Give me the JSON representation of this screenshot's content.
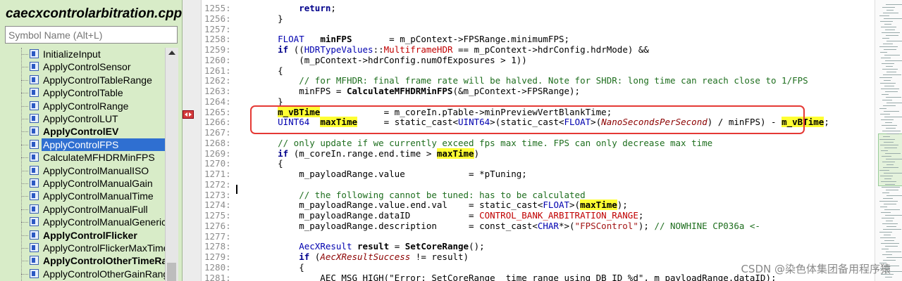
{
  "file_title": "caecxcontrolarbitration.cpp",
  "search": {
    "placeholder": "Symbol Name (Alt+L)"
  },
  "symbols": [
    {
      "label": "InitializeInput",
      "bold": false,
      "selected": false
    },
    {
      "label": "ApplyControlSensor",
      "bold": false,
      "selected": false
    },
    {
      "label": "ApplyControlTableRange",
      "bold": false,
      "selected": false
    },
    {
      "label": "ApplyControlTable",
      "bold": false,
      "selected": false
    },
    {
      "label": "ApplyControlRange",
      "bold": false,
      "selected": false
    },
    {
      "label": "ApplyControlLUT",
      "bold": false,
      "selected": false
    },
    {
      "label": "ApplyControlEV",
      "bold": true,
      "selected": false
    },
    {
      "label": "ApplyControlFPS",
      "bold": false,
      "selected": true
    },
    {
      "label": "CalculateMFHDRMinFPS",
      "bold": false,
      "selected": false
    },
    {
      "label": "ApplyControlManualISO",
      "bold": false,
      "selected": false
    },
    {
      "label": "ApplyControlManualGain",
      "bold": false,
      "selected": false
    },
    {
      "label": "ApplyControlManualTime",
      "bold": false,
      "selected": false
    },
    {
      "label": "ApplyControlManualFull",
      "bold": false,
      "selected": false
    },
    {
      "label": "ApplyControlManualGeneric",
      "bold": false,
      "selected": false
    },
    {
      "label": "ApplyControlFlicker",
      "bold": true,
      "selected": false
    },
    {
      "label": "ApplyControlFlickerMaxTime",
      "bold": false,
      "selected": false
    },
    {
      "label": "ApplyControlOtherTimeRange",
      "bold": true,
      "selected": false
    },
    {
      "label": "ApplyControlOtherGainRange",
      "bold": false,
      "selected": false
    }
  ],
  "code_lines": [
    {
      "n": "1255:",
      "html": "        <span class='kw'>return</span>;"
    },
    {
      "n": "1256:",
      "html": "    }"
    },
    {
      "n": "1257:",
      "html": ""
    },
    {
      "n": "1258:",
      "html": "    <span class='tp'>FLOAT</span>   <b>minFPS</b>       = m_pContext-&gt;FPSRange.minimumFPS;"
    },
    {
      "n": "1259:",
      "html": "    <span class='kw'>if</span> ((<span class='tp'>HDRTypeValues</span>::<span class='mac'>MultiframeHDR</span> == m_pContext-&gt;hdrConfig.hdrMode) &amp;&amp;"
    },
    {
      "n": "1260:",
      "html": "        (m_pContext-&gt;hdrConfig.numOfExposures &gt; 1))"
    },
    {
      "n": "1261:",
      "html": "    {"
    },
    {
      "n": "1262:",
      "html": "        <span class='cm'>// for MFHDR: final frame rate will be halved. Note for SHDR: long time can reach close to 1/FPS</span>"
    },
    {
      "n": "1263:",
      "html": "        minFPS = <span class='fn'>CalculateMFHDRMinFPS</span>(&amp;m_pContext-&gt;FPSRange);"
    },
    {
      "n": "1264:",
      "html": "    }"
    },
    {
      "n": "1265:",
      "html": "    <span class='hl'>m_vBTime</span>            = m_coreIn.pTable-&gt;minPreviewVertBlankTime;"
    },
    {
      "n": "1266:",
      "html": "    <span class='tp'>UINT64</span>  <span class='hl'>maxTime</span>     = static_cast&lt;<span class='tp'>UINT64</span>&gt;(static_cast&lt;<span class='tp'>FLOAT</span>&gt;(<span class='it'>NanoSecondsPerSecond</span>) / minFPS) - <span class='hl'>m_vBTime</span>;"
    },
    {
      "n": "1267:",
      "html": ""
    },
    {
      "n": "1268:",
      "html": "    <span class='cm'>// only update if we currently exceed fps max time. FPS can only decrease max time</span>"
    },
    {
      "n": "1269:",
      "html": "    <span class='kw'>if</span> (m_coreIn.range.end.time &gt; <span class='hl'>maxTime</span>)"
    },
    {
      "n": "1270:",
      "html": "    {"
    },
    {
      "n": "1271:",
      "html": "        m_payloadRange.value            = *pTuning;"
    },
    {
      "n": "1272:",
      "html": ""
    },
    {
      "n": "1273:",
      "html": "        <span class='cm'>// the following cannot be tuned: has to be calculated</span>"
    },
    {
      "n": "1274:",
      "html": "        m_payloadRange.value.end.val    = static_cast&lt;<span class='tp'>FLOAT</span>&gt;(<span class='hl'>maxTime</span>);"
    },
    {
      "n": "1275:",
      "html": "        m_payloadRange.dataID           = <span class='mac'>CONTROL_BANK_ARBITRATION_RANGE</span>;"
    },
    {
      "n": "1276:",
      "html": "        m_payloadRange.description      = const_cast&lt;<span class='tp'>CHAR</span>*&gt;(<span class='st'>\"FPSControl\"</span>); <span class='cm'>// NOWHINE CP036a &lt;-</span>"
    },
    {
      "n": "1277:",
      "html": ""
    },
    {
      "n": "1278:",
      "html": "        <span class='tp'>AecXResult</span> <b>result</b> = <span class='fn'>SetCoreRange</span>();"
    },
    {
      "n": "1279:",
      "html": "        <span class='kw'>if</span> (<span class='it'>AecXResultSuccess</span> != result)"
    },
    {
      "n": "1280:",
      "html": "        {"
    },
    {
      "n": "1281:",
      "html": "            AEC_MSG_HIGH(\"Error: SetCoreRange  time range using DB ID %d\", m_payloadRange.dataID);"
    }
  ],
  "watermark": "CSDN @染色体集团备用程序猿"
}
